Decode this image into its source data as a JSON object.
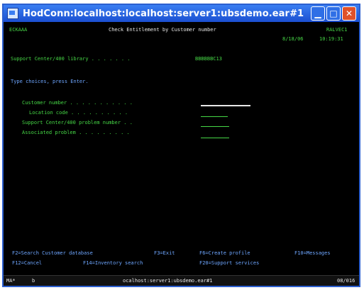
{
  "window": {
    "title": "HodConn:localhost:localhost:server1:ubsdemo.ear#1",
    "icons": {
      "app": "terminal-app-icon",
      "minimize": "minimize-icon",
      "maximize": "maximize-icon",
      "close": "close-icon"
    }
  },
  "screen": {
    "program_id": "ECKAAA",
    "heading": "Check Entitlement by Customer number",
    "system": "RALVEC1",
    "date": "8/18/06",
    "time": "10:19:31",
    "library_label": "Support Center/400 library . . . . . . .",
    "library_value": "BBBBBBC13",
    "instruction": "Type choices, press Enter.",
    "fields": [
      {
        "label": "Customer number . . . . . . . . . . .",
        "highlight": true
      },
      {
        "label": "Location code . . . . . . . . . .",
        "highlight": false
      },
      {
        "label": "Support Center/400 problem number . .",
        "highlight": false
      },
      {
        "label": "Associated problem . . . . . . . . .",
        "highlight": false
      }
    ],
    "fkeys_row1": [
      "F2=Search Customer database",
      "F3=Exit",
      "F6=Create profile",
      "F10=Messages"
    ],
    "fkeys_row2": [
      "F12=Cancel",
      "F14=Inventory search",
      "F20=Support services"
    ]
  },
  "status": {
    "left": "MA*",
    "mode": "b",
    "center": "ocalhost:server1:ubsdemo.ear#1",
    "right": "08/016"
  },
  "colors": {
    "screen_bg": "#000000",
    "text_green": "#46d746",
    "text_white": "#e8e8e8",
    "title_blue": "#2c5fcf"
  }
}
